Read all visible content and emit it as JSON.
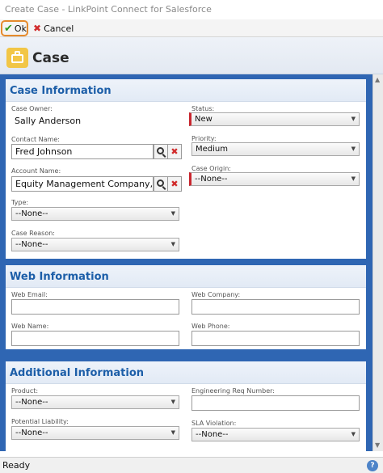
{
  "window": {
    "title": "Create Case - LinkPoint Connect for Salesforce"
  },
  "toolbar": {
    "ok_label": "Ok",
    "cancel_label": "Cancel"
  },
  "header": {
    "title": "Case"
  },
  "case_info": {
    "title": "Case Information",
    "owner_label": "Case Owner:",
    "owner_value": "Sally Anderson",
    "contact_label": "Contact Name:",
    "contact_value": "Fred Johnson",
    "account_label": "Account Name:",
    "account_value": "Equity Management Company, LLC",
    "type_label": "Type:",
    "type_value": "--None--",
    "reason_label": "Case Reason:",
    "reason_value": "--None--",
    "status_label": "Status:",
    "status_value": "New",
    "priority_label": "Priority:",
    "priority_value": "Medium",
    "origin_label": "Case Origin:",
    "origin_value": "--None--"
  },
  "web_info": {
    "title": "Web Information",
    "email_label": "Web Email:",
    "email_value": "",
    "company_label": "Web Company:",
    "company_value": "",
    "name_label": "Web Name:",
    "name_value": "",
    "phone_label": "Web Phone:",
    "phone_value": ""
  },
  "additional_info": {
    "title": "Additional Information",
    "product_label": "Product:",
    "product_value": "--None--",
    "eng_label": "Engineering Req Number:",
    "eng_value": "",
    "liability_label": "Potential Liability:",
    "liability_value": "--None--",
    "sla_label": "SLA Violation:",
    "sla_value": "--None--"
  },
  "status_bar": {
    "text": "Ready"
  },
  "icons": {
    "ok": "check-icon",
    "cancel": "x-icon",
    "header": "briefcase-icon",
    "lookup": "magnifier-icon",
    "clear": "clear-x-icon",
    "help": "help-icon"
  },
  "colors": {
    "accent_blue": "#2f66b3",
    "section_title": "#1c5ea8",
    "required_marker": "#c8262e",
    "ok_highlight": "#e58a2c",
    "case_icon": "#f2c646"
  }
}
